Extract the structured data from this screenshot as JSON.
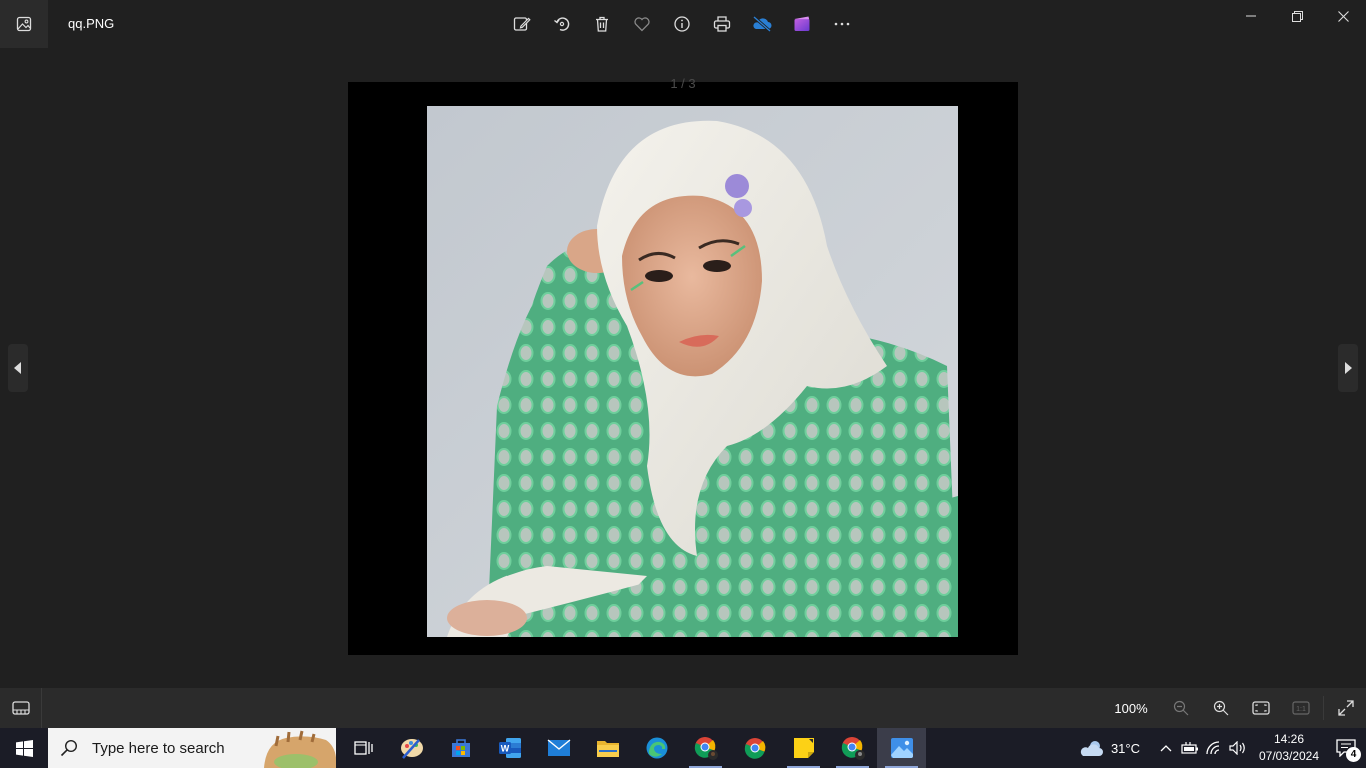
{
  "window": {
    "file_name": "qq.PNG",
    "app_icon": "photos-app-icon",
    "toolbar": [
      {
        "name": "edit-image-icon"
      },
      {
        "name": "rotate-icon"
      },
      {
        "name": "delete-icon"
      },
      {
        "name": "favorite-icon"
      },
      {
        "name": "file-info-icon"
      },
      {
        "name": "print-icon"
      },
      {
        "name": "onedrive-icon"
      },
      {
        "name": "video-editor-icon"
      },
      {
        "name": "more-options-icon"
      }
    ],
    "controls": [
      "minimize-icon",
      "restore-icon",
      "close-icon"
    ]
  },
  "viewer": {
    "page_indicator": "1 / 3",
    "photo_subject": "portrait-photo"
  },
  "bottom_bar": {
    "zoom_level": "100%",
    "buttons": [
      "filmstrip-icon",
      "zoom-out-icon",
      "zoom-in-icon",
      "fit-to-window-icon",
      "actual-size-icon",
      "fullscreen-icon"
    ]
  },
  "taskbar": {
    "search_placeholder": "Type here to search",
    "apps": [
      {
        "name": "task-view-icon"
      },
      {
        "name": "paint-app-icon"
      },
      {
        "name": "microsoft-store-icon"
      },
      {
        "name": "word-icon"
      },
      {
        "name": "mail-icon"
      },
      {
        "name": "file-explorer-icon"
      },
      {
        "name": "edge-icon"
      },
      {
        "name": "chrome-profile-icon"
      },
      {
        "name": "chrome-icon"
      },
      {
        "name": "sticky-notes-icon"
      },
      {
        "name": "chrome-profile-2-icon"
      },
      {
        "name": "photos-icon"
      }
    ],
    "weather_temp": "31°C",
    "time": "14:26",
    "date": "07/03/2024",
    "notification_count": "4",
    "colors": {
      "accent": "#8fa6d8",
      "sweater": "#5cb98a",
      "background": "#c9ced4"
    }
  }
}
